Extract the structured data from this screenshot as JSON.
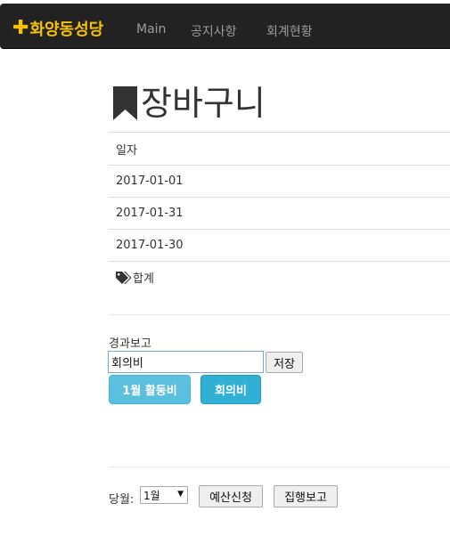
{
  "navbar": {
    "brand": "화양동성당",
    "brand_icon": "plus-icon",
    "links": [
      "Main",
      "공지사항",
      "회계현황"
    ],
    "colors": {
      "background": "#222222",
      "brand": "#f7c203",
      "link": "#9d9d9d"
    }
  },
  "page": {
    "title": "장바구니",
    "title_icon": "bookmark-icon"
  },
  "table": {
    "header": "일자",
    "dates": [
      "2017-01-01",
      "2017-01-31",
      "2017-01-30"
    ],
    "total_label": "합계",
    "total_icon": "tags-icon"
  },
  "report": {
    "label": "경과보고",
    "input_value": "회의비",
    "save_label": "저장",
    "tags": [
      "1월 활동비",
      "회의비"
    ]
  },
  "footer": {
    "month_label": "당월:",
    "month_selected": "1월",
    "budget_button": "예산신청",
    "exec_button": "집행보고"
  }
}
